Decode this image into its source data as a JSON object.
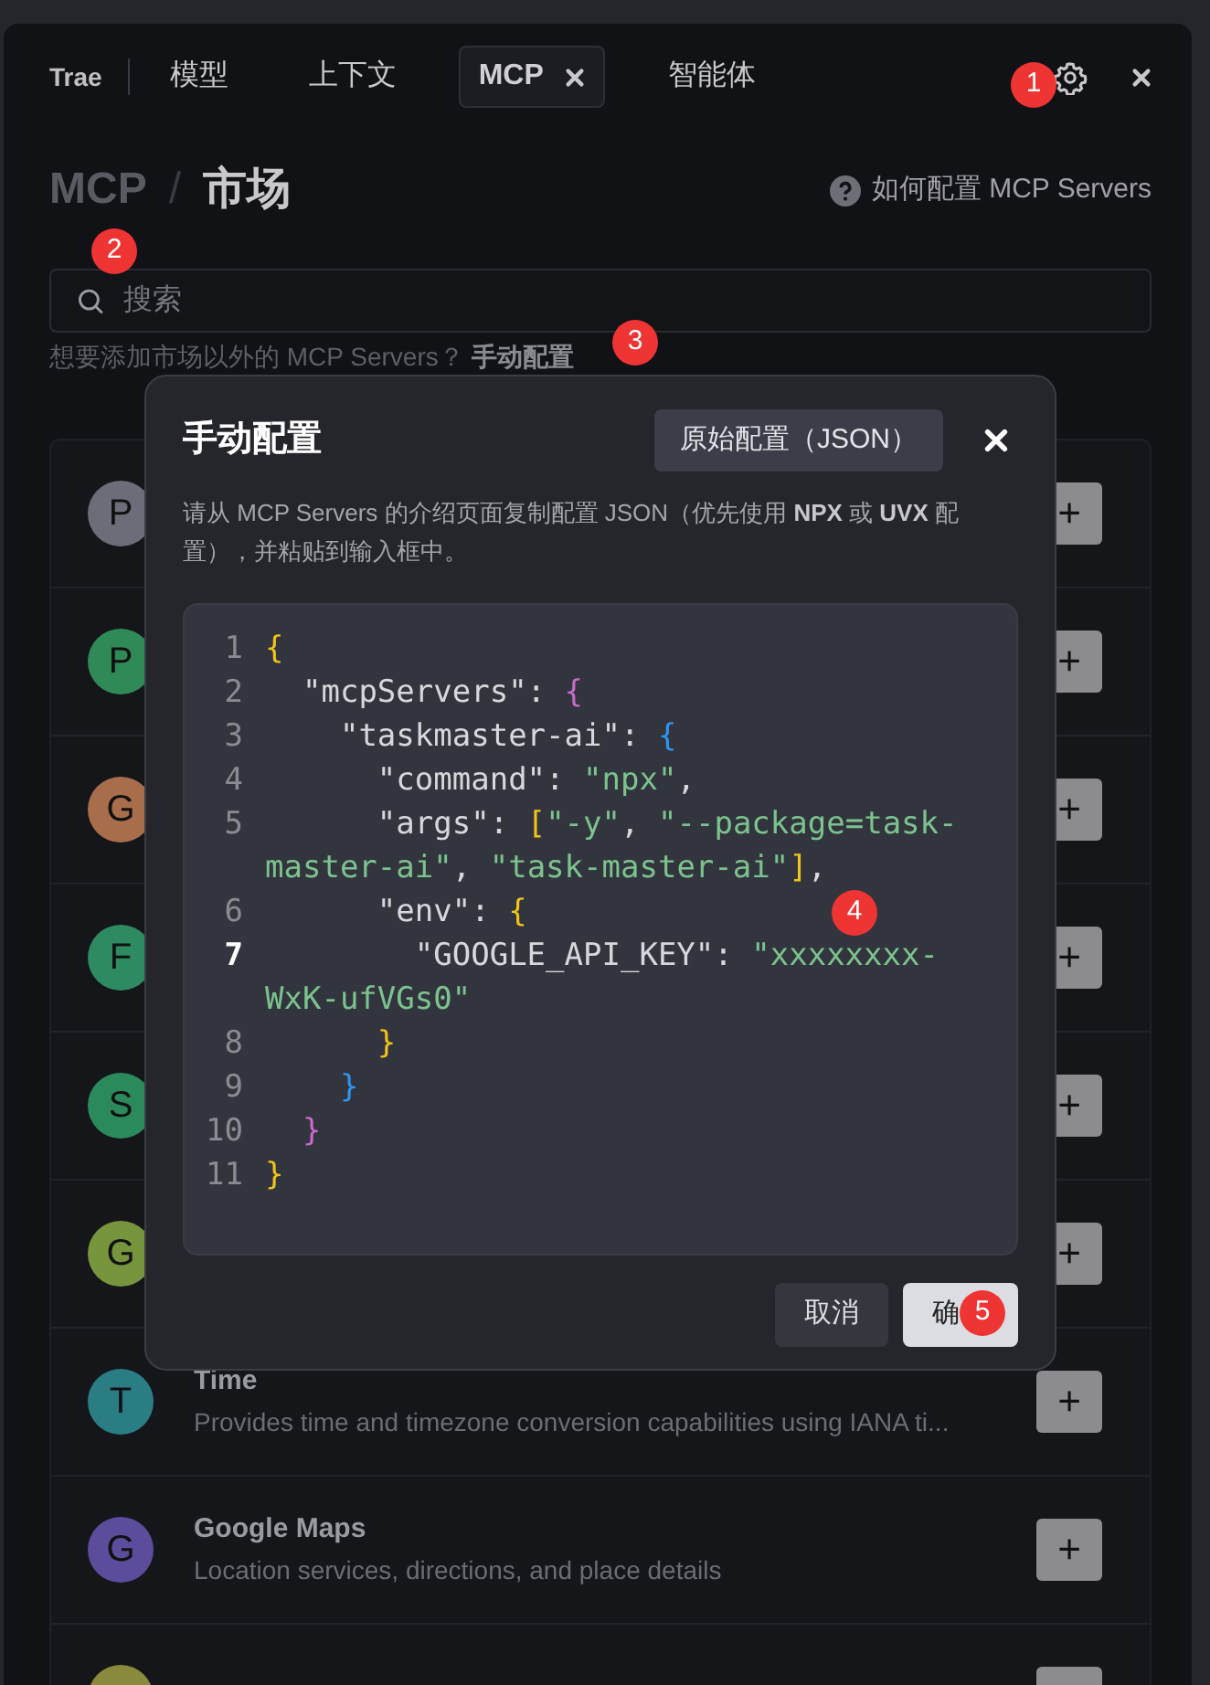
{
  "tabs": [
    {
      "label": "Trae",
      "kind": "brand",
      "selected": false
    },
    {
      "label": "模型",
      "kind": "tab",
      "selected": false
    },
    {
      "label": "上下文",
      "kind": "tab",
      "selected": false
    },
    {
      "label": "MCP",
      "kind": "closable",
      "selected": true
    },
    {
      "label": "智能体",
      "kind": "tab",
      "selected": false
    }
  ],
  "breadcrumb": [
    "MCP",
    "市场"
  ],
  "breadcrumb_separator": "/",
  "add_label": "+",
  "help_link": "如何配置 MCP Servers",
  "search": {
    "placeholder": "搜索"
  },
  "hint": {
    "text": "想要添加市场以外的 MCP Servers？",
    "link": "手动配置"
  },
  "servers": [
    {
      "avatar": "P",
      "color": "#6b6e78"
    },
    {
      "avatar": "P",
      "color": "#2f8a57"
    },
    {
      "avatar": "G",
      "color": "#a86d4b"
    },
    {
      "avatar": "F",
      "color": "#2e8a60"
    },
    {
      "avatar": "S",
      "color": "#2b8a5b"
    },
    {
      "avatar": "G",
      "color": "#76953c"
    },
    {
      "avatar": "T",
      "color": "#2b7d84",
      "name": "Time",
      "description": "Provides time and timezone conversion capabilities using IANA ti..."
    },
    {
      "avatar": "G",
      "color": "#5b4c9c",
      "name": "Google Maps",
      "description": "Location services, directions, and place details"
    },
    {
      "color": "#8a8a3c"
    }
  ],
  "dialog": {
    "title": "手动配置",
    "mode_button": "原始配置（JSON）",
    "description": "请从 MCP Servers 的介绍页面复制配置 JSON（优先使用 **NPX** 或 **UVX** 配置），并粘贴到输入框中。",
    "code": [
      {
        "number": "1",
        "current": false,
        "tokens": [
          {
            "text": "{",
            "kind": "b1"
          }
        ]
      },
      {
        "number": "2",
        "current": false,
        "tokens": [
          {
            "text": "  \"mcpServers\": ",
            "kind": "key"
          },
          {
            "text": "{",
            "kind": "b2"
          }
        ]
      },
      {
        "number": "3",
        "current": false,
        "tokens": [
          {
            "text": "    \"taskmaster-ai\": ",
            "kind": "key"
          },
          {
            "text": "{",
            "kind": "b3"
          }
        ]
      },
      {
        "number": "4",
        "current": false,
        "tokens": [
          {
            "text": "      \"command\": ",
            "kind": "key"
          },
          {
            "text": "\"npx\"",
            "kind": "string"
          },
          {
            "text": ",",
            "kind": "key"
          }
        ]
      },
      {
        "number": "5",
        "current": false,
        "tokens": [
          {
            "text": "      \"args\": ",
            "kind": "key"
          },
          {
            "text": "[",
            "kind": "b1"
          },
          {
            "text": "\"-y\"",
            "kind": "string"
          },
          {
            "text": ", ",
            "kind": "key"
          },
          {
            "text": "\"--package=task-master-ai\"",
            "kind": "string"
          },
          {
            "text": ", ",
            "kind": "key"
          },
          {
            "text": "\"task-master-ai\"",
            "kind": "string"
          },
          {
            "text": "]",
            "kind": "b1"
          },
          {
            "text": ",",
            "kind": "key"
          }
        ]
      },
      {
        "number": "6",
        "current": false,
        "tokens": [
          {
            "text": "      \"env\": ",
            "kind": "key"
          },
          {
            "text": "{",
            "kind": "b1"
          }
        ]
      },
      {
        "number": "7",
        "current": true,
        "tokens": [
          {
            "text": "        \"GOOGLE_API_KEY\": ",
            "kind": "key"
          },
          {
            "text": "\"xxxxxxxx-WxK-ufVGs0\"",
            "kind": "string"
          }
        ]
      },
      {
        "number": "8",
        "current": false,
        "tokens": [
          {
            "text": "      }",
            "kind": "b1"
          }
        ]
      },
      {
        "number": "9",
        "current": false,
        "tokens": [
          {
            "text": "    }",
            "kind": "b3"
          }
        ]
      },
      {
        "number": "10",
        "current": false,
        "tokens": [
          {
            "text": "  }",
            "kind": "b2"
          }
        ]
      },
      {
        "number": "11",
        "current": false,
        "tokens": [
          {
            "text": "}",
            "kind": "b1"
          }
        ]
      }
    ],
    "buttons": [
      {
        "label": "取消",
        "kind": "secondary"
      },
      {
        "label": "确",
        "kind": "primary"
      }
    ]
  },
  "callouts": [
    "1",
    "2",
    "3",
    "4",
    "5"
  ]
}
